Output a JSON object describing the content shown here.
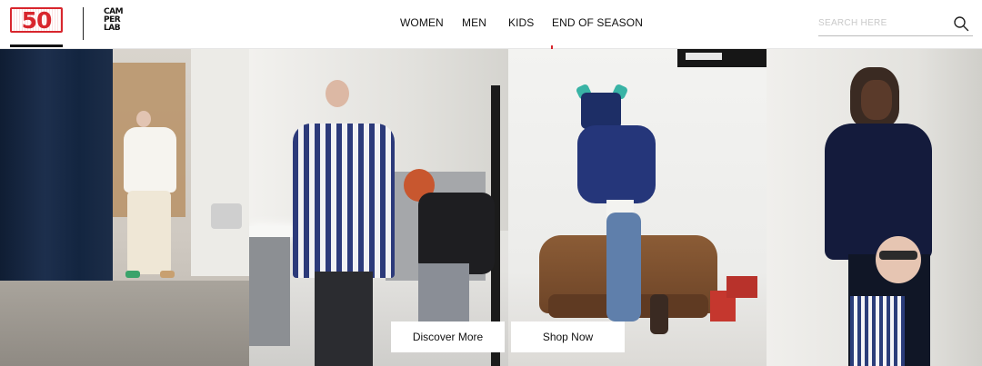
{
  "header": {
    "logo_50": {
      "text": "50",
      "icon": "camper-50-logo",
      "color": "#d8262d"
    },
    "logo_camperlab": {
      "lines": [
        "CAM",
        "PER",
        "LAB"
      ],
      "icon": "camperlab-logo"
    },
    "nav": [
      {
        "label": "WOMEN"
      },
      {
        "label": "MEN"
      },
      {
        "label": "KIDS"
      },
      {
        "label": "END OF SEASON"
      }
    ],
    "search": {
      "value": "",
      "placeholder": "SEARCH HERE",
      "icon": "search-icon"
    }
  },
  "hero": {
    "panels": [
      {
        "icon": "photo-model-white-outfit"
      },
      {
        "icon": "photo-model-striped-shirt"
      },
      {
        "icon": "photo-model-handstand"
      },
      {
        "icon": "photo-model-phone-call"
      }
    ],
    "buttons": {
      "discover_label": "Discover More",
      "shop_label": "Shop Now"
    }
  },
  "colors": {
    "accent": "#d8262d",
    "text": "#111111",
    "background": "#ffffff"
  }
}
